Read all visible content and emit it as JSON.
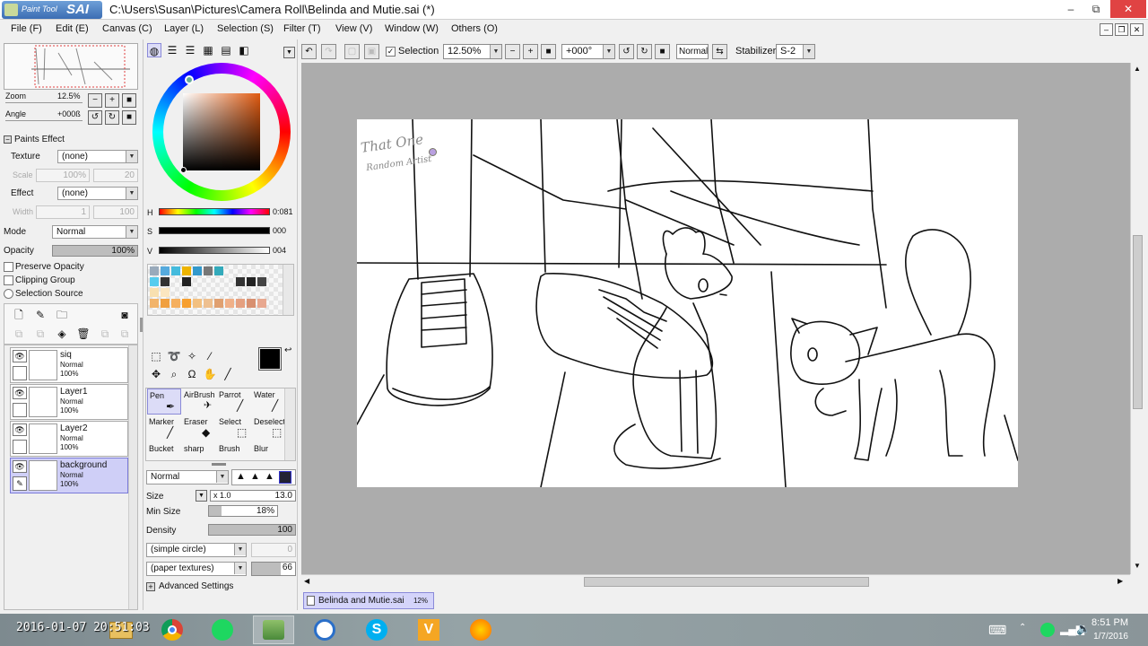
{
  "window": {
    "app_logo_small": "Paint Tool",
    "app_logo_big": "SAI",
    "title": "C:\\Users\\Susan\\Pictures\\Camera Roll\\Belinda and Mutie.sai (*)",
    "min": "‒",
    "restore": "⧉",
    "close": "✕"
  },
  "menu": [
    "File (F)",
    "Edit (E)",
    "Canvas (C)",
    "Layer (L)",
    "Selection (S)",
    "Filter (T)",
    "View (V)",
    "Window (W)",
    "Others (O)"
  ],
  "navigator": {
    "zoom_label": "Zoom",
    "zoom_value": "12.5%",
    "angle_label": "Angle",
    "angle_value": "+000ß"
  },
  "paints_effect": {
    "header": "Paints Effect",
    "texture_label": "Texture",
    "texture_value": "(none)",
    "scale_label": "Scale",
    "scale_value": "100%",
    "scale_num": "20",
    "effect_label": "Effect",
    "effect_value": "(none)",
    "width_label": "Width",
    "width_value": "1",
    "width_num": "100"
  },
  "layer_props": {
    "mode_label": "Mode",
    "mode_value": "Normal",
    "opacity_label": "Opacity",
    "opacity_value": "100%",
    "opacity_fraction": 1.0,
    "preserve_opacity": "Preserve Opacity",
    "clipping_group": "Clipping Group",
    "selection_source": "Selection Source"
  },
  "layers": [
    {
      "name": "siq",
      "mode": "Normal",
      "opacity": "100%",
      "selected": false
    },
    {
      "name": "Layer1",
      "mode": "Normal",
      "opacity": "100%",
      "selected": false
    },
    {
      "name": "Layer2",
      "mode": "Normal",
      "opacity": "100%",
      "selected": false
    },
    {
      "name": "background",
      "mode": "Normal",
      "opacity": "100%",
      "selected": true
    }
  ],
  "color": {
    "h_label": "H",
    "h_value": "0:081",
    "s_label": "S",
    "s_value": "000",
    "v_label": "V",
    "v_value": "004",
    "current_color": "#000000"
  },
  "tools": [
    {
      "label": "Pen",
      "selected": true
    },
    {
      "label": "AirBrush",
      "selected": false
    },
    {
      "label": "Parrot",
      "selected": false
    },
    {
      "label": "Water",
      "selected": false
    },
    {
      "label": "Marker",
      "selected": false
    },
    {
      "label": "Eraser",
      "selected": false
    },
    {
      "label": "Select",
      "selected": false
    },
    {
      "label": "Deselect",
      "selected": false
    },
    {
      "label": "Bucket",
      "selected": false
    },
    {
      "label": "sharp",
      "selected": false
    },
    {
      "label": "Brush",
      "selected": false
    },
    {
      "label": "Blur",
      "selected": false
    }
  ],
  "brush": {
    "blend_mode": "Normal",
    "size_label": "Size",
    "size_mult": "x 1.0",
    "size_value": "13.0",
    "min_size_label": "Min Size",
    "min_size_value": "18%",
    "min_size_fraction": 0.18,
    "density_label": "Density",
    "density_value": "100",
    "density_fraction": 1.0,
    "shape": "(simple circle)",
    "shape_num": "0",
    "texture": "(paper textures)",
    "texture_num": "66",
    "advanced": "Advanced Settings"
  },
  "toolbar": {
    "selection_label": "Selection",
    "selection_checked": true,
    "zoom_value": "12.50%",
    "angle_value": "+000°",
    "blend_mode": "Normal",
    "stabilizer_label": "Stabilizer",
    "stabilizer_value": "S-2"
  },
  "canvas": {
    "signature_line1": "That One",
    "signature_line2": "Random Artist"
  },
  "document_tab": {
    "name": "Belinda and Mutie.sai",
    "zoom": "12%"
  },
  "taskbar": {
    "overlay_timestamp": "2016-01-07 20:51:03",
    "time": "8:51 PM",
    "date": "1/7/2016",
    "apps": [
      "file-explorer",
      "chrome",
      "spotify",
      "paint-tool-sai",
      "clock-app",
      "skype",
      "vectr",
      "sun-app"
    ]
  }
}
